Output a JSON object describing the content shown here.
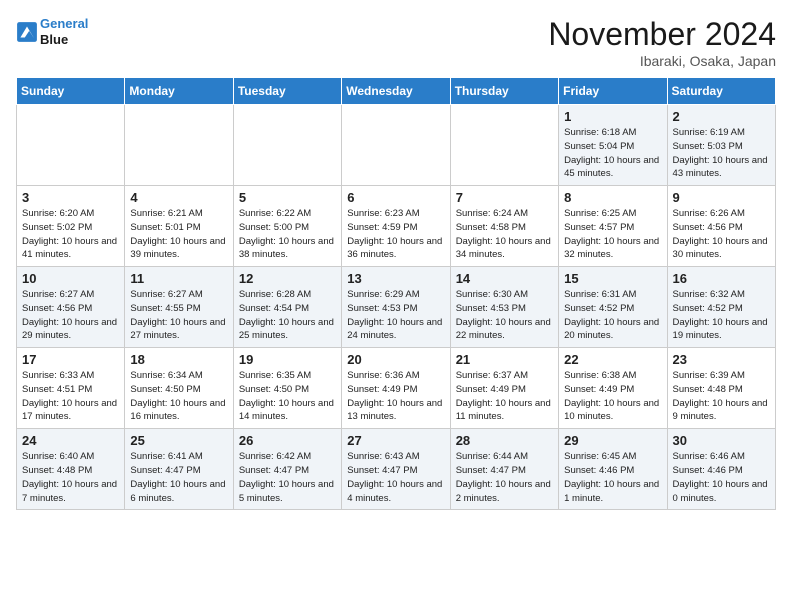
{
  "header": {
    "logo_line1": "General",
    "logo_line2": "Blue",
    "month_title": "November 2024",
    "location": "Ibaraki, Osaka, Japan"
  },
  "weekdays": [
    "Sunday",
    "Monday",
    "Tuesday",
    "Wednesday",
    "Thursday",
    "Friday",
    "Saturday"
  ],
  "weeks": [
    [
      {
        "day": "",
        "info": ""
      },
      {
        "day": "",
        "info": ""
      },
      {
        "day": "",
        "info": ""
      },
      {
        "day": "",
        "info": ""
      },
      {
        "day": "",
        "info": ""
      },
      {
        "day": "1",
        "info": "Sunrise: 6:18 AM\nSunset: 5:04 PM\nDaylight: 10 hours and 45 minutes."
      },
      {
        "day": "2",
        "info": "Sunrise: 6:19 AM\nSunset: 5:03 PM\nDaylight: 10 hours and 43 minutes."
      }
    ],
    [
      {
        "day": "3",
        "info": "Sunrise: 6:20 AM\nSunset: 5:02 PM\nDaylight: 10 hours and 41 minutes."
      },
      {
        "day": "4",
        "info": "Sunrise: 6:21 AM\nSunset: 5:01 PM\nDaylight: 10 hours and 39 minutes."
      },
      {
        "day": "5",
        "info": "Sunrise: 6:22 AM\nSunset: 5:00 PM\nDaylight: 10 hours and 38 minutes."
      },
      {
        "day": "6",
        "info": "Sunrise: 6:23 AM\nSunset: 4:59 PM\nDaylight: 10 hours and 36 minutes."
      },
      {
        "day": "7",
        "info": "Sunrise: 6:24 AM\nSunset: 4:58 PM\nDaylight: 10 hours and 34 minutes."
      },
      {
        "day": "8",
        "info": "Sunrise: 6:25 AM\nSunset: 4:57 PM\nDaylight: 10 hours and 32 minutes."
      },
      {
        "day": "9",
        "info": "Sunrise: 6:26 AM\nSunset: 4:56 PM\nDaylight: 10 hours and 30 minutes."
      }
    ],
    [
      {
        "day": "10",
        "info": "Sunrise: 6:27 AM\nSunset: 4:56 PM\nDaylight: 10 hours and 29 minutes."
      },
      {
        "day": "11",
        "info": "Sunrise: 6:27 AM\nSunset: 4:55 PM\nDaylight: 10 hours and 27 minutes."
      },
      {
        "day": "12",
        "info": "Sunrise: 6:28 AM\nSunset: 4:54 PM\nDaylight: 10 hours and 25 minutes."
      },
      {
        "day": "13",
        "info": "Sunrise: 6:29 AM\nSunset: 4:53 PM\nDaylight: 10 hours and 24 minutes."
      },
      {
        "day": "14",
        "info": "Sunrise: 6:30 AM\nSunset: 4:53 PM\nDaylight: 10 hours and 22 minutes."
      },
      {
        "day": "15",
        "info": "Sunrise: 6:31 AM\nSunset: 4:52 PM\nDaylight: 10 hours and 20 minutes."
      },
      {
        "day": "16",
        "info": "Sunrise: 6:32 AM\nSunset: 4:52 PM\nDaylight: 10 hours and 19 minutes."
      }
    ],
    [
      {
        "day": "17",
        "info": "Sunrise: 6:33 AM\nSunset: 4:51 PM\nDaylight: 10 hours and 17 minutes."
      },
      {
        "day": "18",
        "info": "Sunrise: 6:34 AM\nSunset: 4:50 PM\nDaylight: 10 hours and 16 minutes."
      },
      {
        "day": "19",
        "info": "Sunrise: 6:35 AM\nSunset: 4:50 PM\nDaylight: 10 hours and 14 minutes."
      },
      {
        "day": "20",
        "info": "Sunrise: 6:36 AM\nSunset: 4:49 PM\nDaylight: 10 hours and 13 minutes."
      },
      {
        "day": "21",
        "info": "Sunrise: 6:37 AM\nSunset: 4:49 PM\nDaylight: 10 hours and 11 minutes."
      },
      {
        "day": "22",
        "info": "Sunrise: 6:38 AM\nSunset: 4:49 PM\nDaylight: 10 hours and 10 minutes."
      },
      {
        "day": "23",
        "info": "Sunrise: 6:39 AM\nSunset: 4:48 PM\nDaylight: 10 hours and 9 minutes."
      }
    ],
    [
      {
        "day": "24",
        "info": "Sunrise: 6:40 AM\nSunset: 4:48 PM\nDaylight: 10 hours and 7 minutes."
      },
      {
        "day": "25",
        "info": "Sunrise: 6:41 AM\nSunset: 4:47 PM\nDaylight: 10 hours and 6 minutes."
      },
      {
        "day": "26",
        "info": "Sunrise: 6:42 AM\nSunset: 4:47 PM\nDaylight: 10 hours and 5 minutes."
      },
      {
        "day": "27",
        "info": "Sunrise: 6:43 AM\nSunset: 4:47 PM\nDaylight: 10 hours and 4 minutes."
      },
      {
        "day": "28",
        "info": "Sunrise: 6:44 AM\nSunset: 4:47 PM\nDaylight: 10 hours and 2 minutes."
      },
      {
        "day": "29",
        "info": "Sunrise: 6:45 AM\nSunset: 4:46 PM\nDaylight: 10 hours and 1 minute."
      },
      {
        "day": "30",
        "info": "Sunrise: 6:46 AM\nSunset: 4:46 PM\nDaylight: 10 hours and 0 minutes."
      }
    ]
  ]
}
